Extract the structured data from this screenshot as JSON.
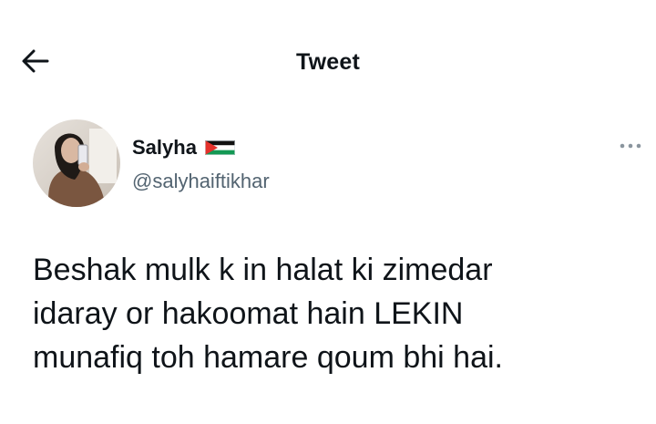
{
  "header": {
    "title": "Tweet",
    "back_icon": "arrow-left-icon"
  },
  "author": {
    "display_name": "Salyha",
    "handle": "@salyhaiftikhar",
    "badge_icon": "palestine-flag-icon",
    "avatar_icon": "avatar"
  },
  "tweet": {
    "lines": [
      "Beshak mulk k in halat ki zimedar",
      "idaray or hakoomat hain LEKIN",
      "munafiq toh hamare qoum bhi hai."
    ]
  },
  "more_icon": "more-options-icon",
  "colors": {
    "text": "#0f1419",
    "secondary": "#536471",
    "background": "#ffffff"
  }
}
